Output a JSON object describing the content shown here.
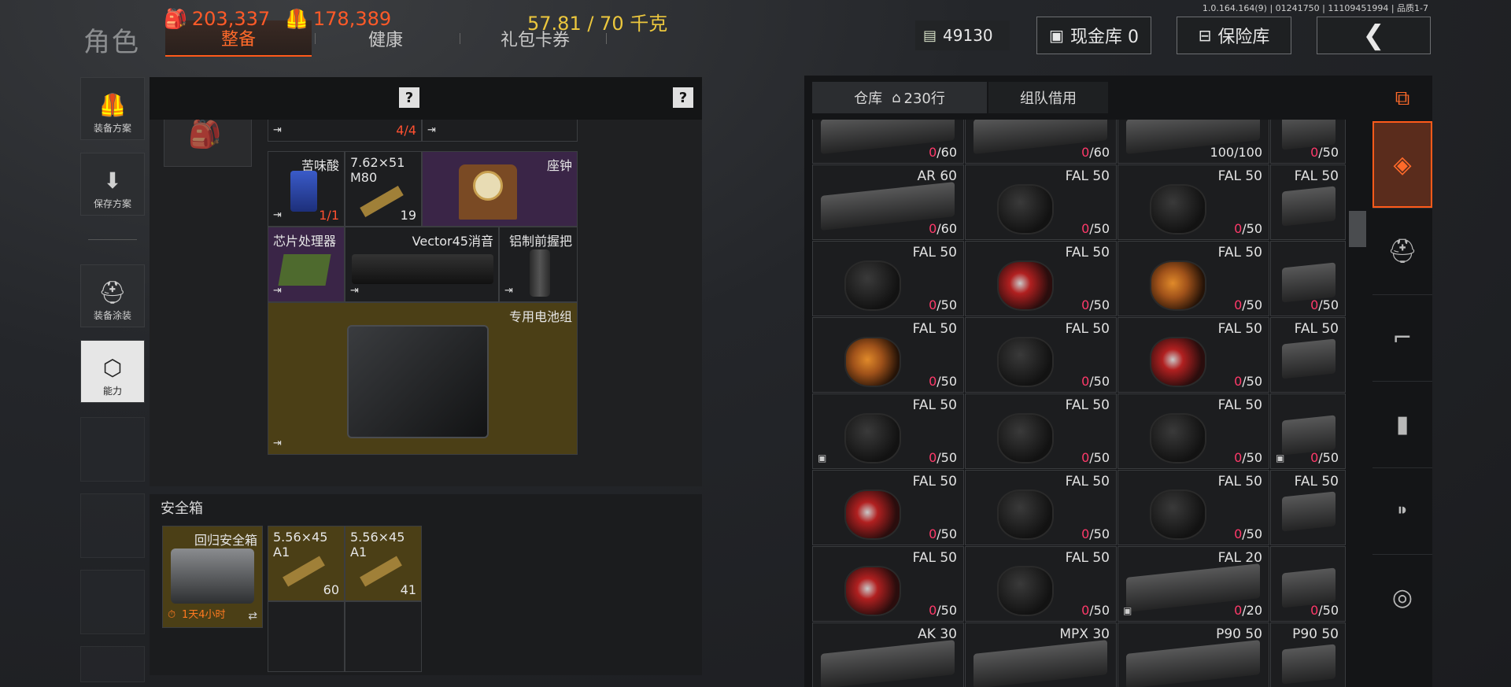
{
  "version": "1.0.164.164(9) | 01241750 | 11109451994 | 品质1-7",
  "header": {
    "title": "角色",
    "tabs": [
      "整备",
      "健康",
      "礼包卡券"
    ],
    "money": "49130",
    "cash_vault": "现金库 0",
    "insurance_vault": "保险库"
  },
  "sidebar": {
    "items": [
      {
        "label": "装备方案",
        "icon": "vest-icon"
      },
      {
        "label": "保存方案",
        "icon": "download-icon"
      },
      {
        "label": "装备涂装",
        "icon": "helmet-icon"
      },
      {
        "label": "能力",
        "icon": "lightning-hex-icon"
      }
    ]
  },
  "stats": {
    "bag_value": "203,337",
    "vest_value": "178,389",
    "weight": "57.81 / 70 千克",
    "help": "?"
  },
  "bag": {
    "top_row": [
      {
        "count": "4/4"
      }
    ],
    "items": [
      {
        "name": "苦味酸",
        "count": "1/1"
      },
      {
        "name": "7.62×51 M80",
        "count": "19"
      },
      {
        "name": "座钟",
        "count": ""
      },
      {
        "name": "芯片处理器",
        "count": ""
      },
      {
        "name": "Vector45消音",
        "count": ""
      },
      {
        "name": "铝制前握把",
        "count": ""
      },
      {
        "name": "专用电池组",
        "count": ""
      }
    ]
  },
  "safe_box": {
    "title": "安全箱",
    "container_name": "回归安全箱",
    "timer": "1天4小时",
    "items": [
      {
        "name": "5.56×45 A1",
        "count": "60"
      },
      {
        "name": "5.56×45 A1",
        "count": "41"
      }
    ]
  },
  "warehouse": {
    "tab_storage": "仓库",
    "rows_count": "230行",
    "tab_team": "组队借用",
    "rows": [
      [
        {
          "name": "",
          "fill": "0",
          "cap": "60"
        },
        {
          "name": "",
          "fill": "0",
          "cap": "60"
        },
        {
          "name": "",
          "fill": "100",
          "cap": "100"
        },
        {
          "name": "",
          "fill": "0",
          "cap": "50"
        }
      ],
      [
        {
          "name": "AR 60",
          "fill": "0",
          "cap": "60"
        },
        {
          "name": "FAL 50",
          "fill": "0",
          "cap": "50"
        },
        {
          "name": "FAL 50",
          "fill": "0",
          "cap": "50"
        },
        {
          "name": "FAL 50",
          "fill": "",
          "cap": ""
        }
      ],
      [
        {
          "name": "FAL 50",
          "fill": "0",
          "cap": "50"
        },
        {
          "name": "FAL 50",
          "fill": "0",
          "cap": "50"
        },
        {
          "name": "FAL 50",
          "fill": "0",
          "cap": "50"
        },
        {
          "name": "",
          "fill": "0",
          "cap": "50"
        }
      ],
      [
        {
          "name": "FAL 50",
          "fill": "0",
          "cap": "50"
        },
        {
          "name": "FAL 50",
          "fill": "0",
          "cap": "50"
        },
        {
          "name": "FAL 50",
          "fill": "0",
          "cap": "50"
        },
        {
          "name": "FAL 50",
          "fill": "",
          "cap": ""
        }
      ],
      [
        {
          "name": "FAL 50",
          "fill": "0",
          "cap": "50"
        },
        {
          "name": "FAL 50",
          "fill": "0",
          "cap": "50"
        },
        {
          "name": "FAL 50",
          "fill": "0",
          "cap": "50"
        },
        {
          "name": "",
          "fill": "0",
          "cap": "50"
        }
      ],
      [
        {
          "name": "FAL 50",
          "fill": "0",
          "cap": "50"
        },
        {
          "name": "FAL 50",
          "fill": "0",
          "cap": "50"
        },
        {
          "name": "FAL 50",
          "fill": "0",
          "cap": "50"
        },
        {
          "name": "FAL 50",
          "fill": "",
          "cap": ""
        }
      ],
      [
        {
          "name": "FAL 50",
          "fill": "0",
          "cap": "50"
        },
        {
          "name": "FAL 50",
          "fill": "0",
          "cap": "50"
        },
        {
          "name": "FAL 20",
          "fill": "0",
          "cap": "20"
        },
        {
          "name": "",
          "fill": "0",
          "cap": "50"
        }
      ],
      [
        {
          "name": "AK 30",
          "fill": "",
          "cap": ""
        },
        {
          "name": "MPX 30",
          "fill": "",
          "cap": ""
        },
        {
          "name": "P90 50",
          "fill": "",
          "cap": ""
        },
        {
          "name": "P90 50",
          "fill": "",
          "cap": ""
        }
      ]
    ]
  },
  "filters": [
    "all-items-icon",
    "stack-icon",
    "helmet-icon",
    "rifle-icon",
    "magazine-icon",
    "bullet-icon",
    "scope-icon"
  ],
  "colors": {
    "accent": "#ff5a1a",
    "weight": "#ecc73d",
    "empty_count": "#ff3a6a"
  }
}
